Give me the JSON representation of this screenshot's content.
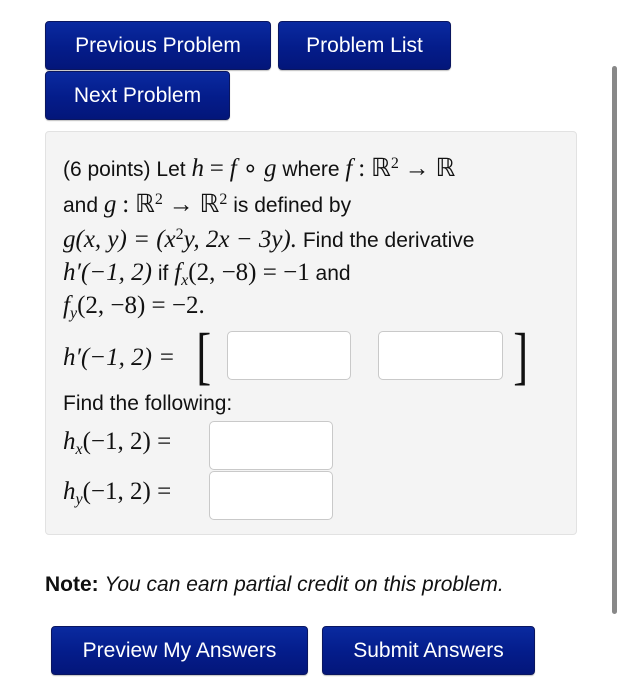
{
  "nav": {
    "previous_label": "Previous Problem",
    "list_label": "Problem List",
    "next_label": "Next Problem"
  },
  "problem": {
    "points": "(6 points)",
    "line1": {
      "let": "Let",
      "h": "h",
      "eq": "=",
      "f": "f",
      "compose": "∘",
      "g": "g",
      "where": "where",
      "f2": "f",
      "colon": ":",
      "R": "ℝ",
      "exp": "2",
      "arrow": "→",
      "R2": "ℝ"
    },
    "line2": {
      "and": "and",
      "g": "g",
      "colon": ":",
      "R": "ℝ",
      "exp1": "2",
      "arrow": "→",
      "R2": "ℝ",
      "exp2": "2",
      "text": "is defined by"
    },
    "line3": {
      "math_a": "g(x, y) = (x",
      "exp": "2",
      "math_b": "y, 2x − 3y).",
      "text": "Find the derivative"
    },
    "line4": {
      "math_a": "h′(−1, 2)",
      "if": "if",
      "f": "f",
      "sub": "x",
      "math_b": "(2, −8) = −1",
      "and": "and"
    },
    "line5": {
      "f": "f",
      "sub": "y",
      "math": "(2, −8) = −2."
    },
    "derivative_label": "h′(−1, 2) =",
    "derivative_inputs": [
      {
        "value": "",
        "placeholder": ""
      },
      {
        "value": "",
        "placeholder": ""
      }
    ],
    "find_following": "Find the following:",
    "hx": {
      "h": "h",
      "sub": "x",
      "rest": "(−1, 2) =",
      "value": ""
    },
    "hy": {
      "h": "h",
      "sub": "y",
      "rest": "(−1, 2) =",
      "value": ""
    }
  },
  "note": {
    "label": "Note:",
    "text": "You can earn partial credit on this problem."
  },
  "actions": {
    "preview_label": "Preview My Answers",
    "submit_label": "Submit Answers"
  },
  "colors": {
    "button_bg": "#041c8a",
    "button_text": "#ffffff",
    "panel_bg": "#f4f4f4"
  }
}
